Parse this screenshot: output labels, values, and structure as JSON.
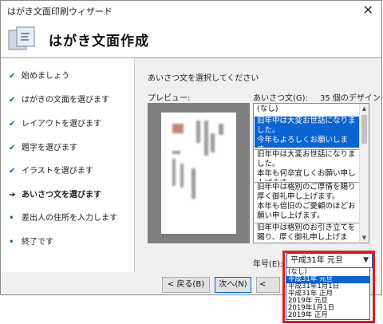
{
  "window": {
    "title": "はがき文面印刷ウィザード",
    "close_glyph": "✕"
  },
  "header": {
    "title": "はがき文面作成"
  },
  "steps": [
    {
      "label": "始めましょう",
      "mark": "✔",
      "state": "done"
    },
    {
      "label": "はがきの文面を選びます",
      "mark": "✔",
      "state": "done"
    },
    {
      "label": "レイアウトを選びます",
      "mark": "✔",
      "state": "done"
    },
    {
      "label": "題字を選びます",
      "mark": "✔",
      "state": "done"
    },
    {
      "label": "イラストを選びます",
      "mark": "✔",
      "state": "done"
    },
    {
      "label": "あいさつ文を選びます",
      "mark": "➔",
      "state": "current"
    },
    {
      "label": "差出人の住所を入力します",
      "mark": "•",
      "state": "todo"
    },
    {
      "label": "終了です",
      "mark": "•",
      "state": "todo"
    }
  ],
  "content": {
    "instruction": "あいさつ文を選択してください",
    "preview_label": "プレビュー:",
    "greeting_label": "あいさつ文(G):",
    "design_count": "35 個のデザイン",
    "greetings": [
      {
        "text": "(なし)"
      },
      {
        "text": "旧年中は大変お世話になりました。\n今年もよろしくお願いします。"
      },
      {
        "text": "旧年中は大変お世話になりました。\n本年も何卒宜しくお願い申し上げます。"
      },
      {
        "text": "旧年中は格別のご厚情を賜り厚く御礼申し上げます。\n本年も倍旧のご愛顧のほどお願い申し上げます。"
      },
      {
        "text": "旧年中は格別のお引き立てを賜り、厚く御礼申し上げます。\n本年も倍旧のご指導のほど、お"
      }
    ],
    "selected_greeting": 1,
    "era_label": "年号(E):",
    "era_selected": "平成31年 元旦",
    "era_options": [
      "(なし)",
      "平成31年 元旦",
      "平成31年1月1日",
      "平成31年 正月",
      "2019年 元旦",
      "2019年1月1日",
      "2019年 正月"
    ],
    "era_highlighted": 1
  },
  "buttons": {
    "back": "< 戻る(B)",
    "next": "次へ(N)",
    "third_partial": "<"
  },
  "colors": {
    "accent": "#0a64d2",
    "highlight_frame": "#e01c1c",
    "check": "#1f5fae"
  },
  "icons": {
    "wizard": "wizard-card-icon",
    "check": "checkmark-icon",
    "current": "arrow-right-icon",
    "scroll_up": "scroll-up-icon",
    "scroll_down": "scroll-down-icon",
    "chevron": "chevron-down-icon"
  }
}
